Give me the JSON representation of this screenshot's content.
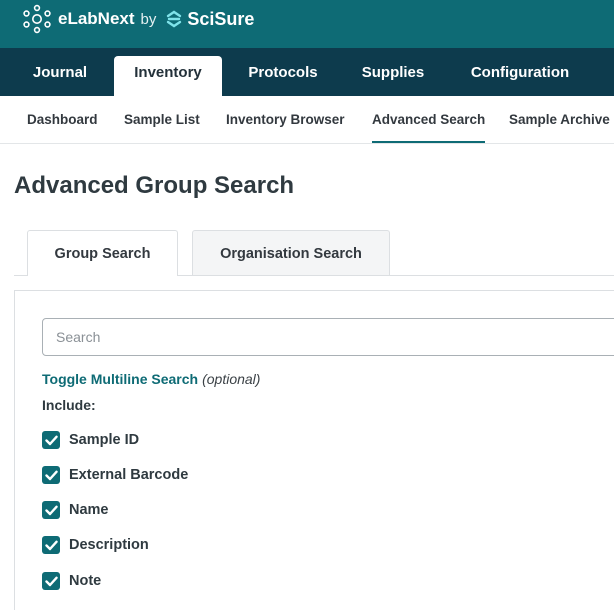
{
  "brand": {
    "name": "eLabNext",
    "by": "by",
    "partner": "SciSure"
  },
  "colors": {
    "topbar": "#0e6b75",
    "mainnav": "#0d3b4d",
    "accent": "#0e6b75"
  },
  "mainnav": {
    "tabs": [
      {
        "label": "Journal"
      },
      {
        "label": "Inventory",
        "active": true
      },
      {
        "label": "Protocols"
      },
      {
        "label": "Supplies"
      },
      {
        "label": "Configuration"
      }
    ]
  },
  "subnav": {
    "items": [
      {
        "label": "Dashboard"
      },
      {
        "label": "Sample List"
      },
      {
        "label": "Inventory Browser"
      },
      {
        "label": "Advanced Search",
        "active": true
      },
      {
        "label": "Sample Archive"
      }
    ]
  },
  "page": {
    "title": "Advanced Group Search",
    "tabs": [
      {
        "label": "Group Search",
        "active": true
      },
      {
        "label": "Organisation Search"
      }
    ]
  },
  "search": {
    "placeholder": "Search",
    "value": "",
    "toggle_label": "Toggle Multiline Search",
    "toggle_optional": "(optional)",
    "include_label": "Include:",
    "fields": [
      {
        "label": "Sample ID",
        "checked": true
      },
      {
        "label": "External Barcode",
        "checked": true
      },
      {
        "label": "Name",
        "checked": true
      },
      {
        "label": "Description",
        "checked": true
      },
      {
        "label": "Note",
        "checked": true
      }
    ]
  }
}
